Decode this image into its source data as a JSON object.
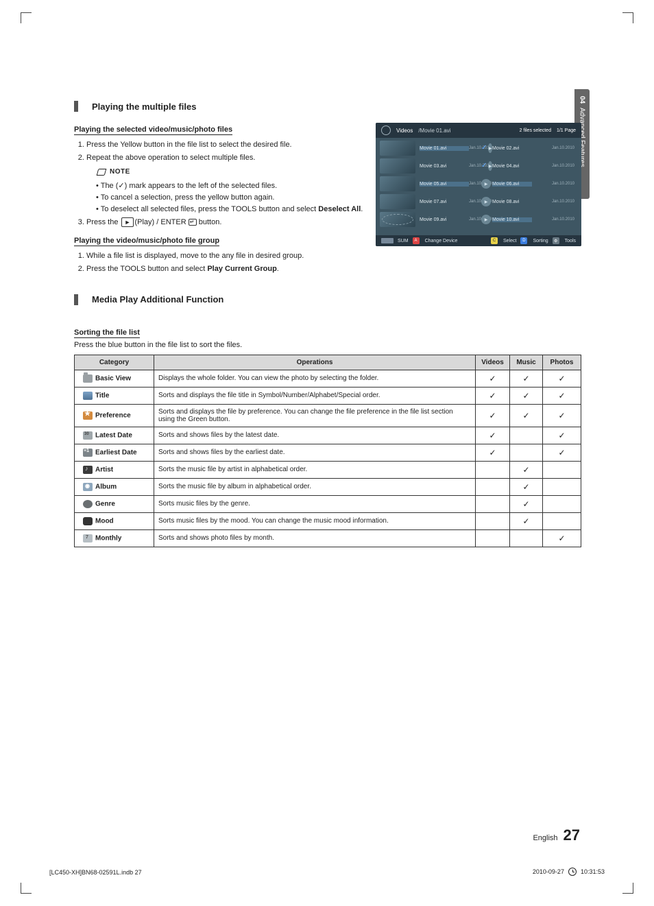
{
  "side_tab": {
    "number": "04",
    "label": "Advanced Features"
  },
  "section1": {
    "title": "Playing the multiple files",
    "sub1": "Playing the selected video/music/photo files",
    "steps1": {
      "s1": "Press the Yellow button in the file list to select the desired file.",
      "s2": "Repeat the above operation to select multiple files.",
      "note_label": "NOTE",
      "n1": "The (✓) mark appears to the left of the selected files.",
      "n2": "To cancel a selection, press the yellow button again.",
      "n3_a": "To deselect all selected files, press the ",
      "n3_tools": "TOOLS",
      "n3_b": " button and select ",
      "n3_bold": "Deselect All",
      "n3_c": ".",
      "s3_a": "Press the ",
      "s3_play": "►",
      "s3_b": "(Play) / ",
      "s3_enter": "ENTER",
      "s3_c": " button."
    },
    "sub2": "Playing the video/music/photo file group",
    "steps2": {
      "s1": "While a file list is displayed, move to the any file in desired group.",
      "s2_a": "Press the ",
      "s2_tools": "TOOLS",
      "s2_b": " button and select ",
      "s2_bold": "Play Current Group",
      "s2_c": "."
    }
  },
  "shot": {
    "bc_videos": "Videos",
    "bc_path": "/Movie 01.avi",
    "selected": "2 files selected",
    "page": "1/1 Page",
    "files": [
      {
        "name": "Movie 01.avi",
        "date": "Jan.10.2010",
        "checked": true
      },
      {
        "name": "Movie 02.avi",
        "date": "Jan.10.2010",
        "checked": false
      },
      {
        "name": "Movie 03.avi",
        "date": "Jan.10.2010",
        "checked": true
      },
      {
        "name": "Movie 04.avi",
        "date": "Jan.10.2010",
        "checked": false
      },
      {
        "name": "Movie 05.avi",
        "date": "Jan.10.2010",
        "checked": false
      },
      {
        "name": "Movie 06.avi",
        "date": "Jan.10.2010",
        "checked": false
      },
      {
        "name": "Movie 07.avi",
        "date": "Jan.10.2010",
        "checked": false
      },
      {
        "name": "Movie 08.avi",
        "date": "Jan.10.2010",
        "checked": false
      },
      {
        "name": "Movie 09.avi",
        "date": "Jan.10.2010",
        "checked": false
      },
      {
        "name": "Movie 10.avi",
        "date": "Jan.10.2010",
        "checked": false
      }
    ],
    "footer": {
      "sum": "SUM",
      "change": "Change Device",
      "select": "Select",
      "sorting": "Sorting",
      "tools": "Tools"
    }
  },
  "section2": {
    "title": "Media Play Additional Function",
    "sort_hdr": "Sorting the file list",
    "sort_desc": "Press the blue button in the file list to sort the files.",
    "cols": {
      "category": "Category",
      "ops": "Operations",
      "videos": "Videos",
      "music": "Music",
      "photos": "Photos"
    },
    "rows": [
      {
        "cat": "Basic View",
        "op": "Displays the whole folder. You can view the photo by selecting the folder.",
        "v": "✓",
        "m": "✓",
        "p": "✓"
      },
      {
        "cat": "Title",
        "op": "Sorts and displays the file title in Symbol/Number/Alphabet/Special order.",
        "v": "✓",
        "m": "✓",
        "p": "✓"
      },
      {
        "cat": "Preference",
        "op": "Sorts and displays the file by preference. You can change the file preference in the file list section using the Green button.",
        "v": "✓",
        "m": "✓",
        "p": "✓"
      },
      {
        "cat": "Latest Date",
        "op": "Sorts and shows files by the latest date.",
        "v": "✓",
        "m": "",
        "p": "✓"
      },
      {
        "cat": "Earliest Date",
        "op": "Sorts and shows files by the earliest date.",
        "v": "✓",
        "m": "",
        "p": "✓"
      },
      {
        "cat": "Artist",
        "op": "Sorts the music file by artist in alphabetical order.",
        "v": "",
        "m": "✓",
        "p": ""
      },
      {
        "cat": "Album",
        "op": "Sorts the music file by album in alphabetical order.",
        "v": "",
        "m": "✓",
        "p": ""
      },
      {
        "cat": "Genre",
        "op": "Sorts music files by the genre.",
        "v": "",
        "m": "✓",
        "p": ""
      },
      {
        "cat": "Mood",
        "op": "Sorts music files by the mood. You can change the music mood information.",
        "v": "",
        "m": "✓",
        "p": ""
      },
      {
        "cat": "Monthly",
        "op": "Sorts and shows photo files by month.",
        "v": "",
        "m": "",
        "p": "✓"
      }
    ]
  },
  "footer": {
    "lang": "English",
    "page": "27",
    "print_left": "[LC450-XH]BN68-02591L.indb   27",
    "print_right_date": "2010-09-27",
    "print_right_time": "10:31:53"
  }
}
